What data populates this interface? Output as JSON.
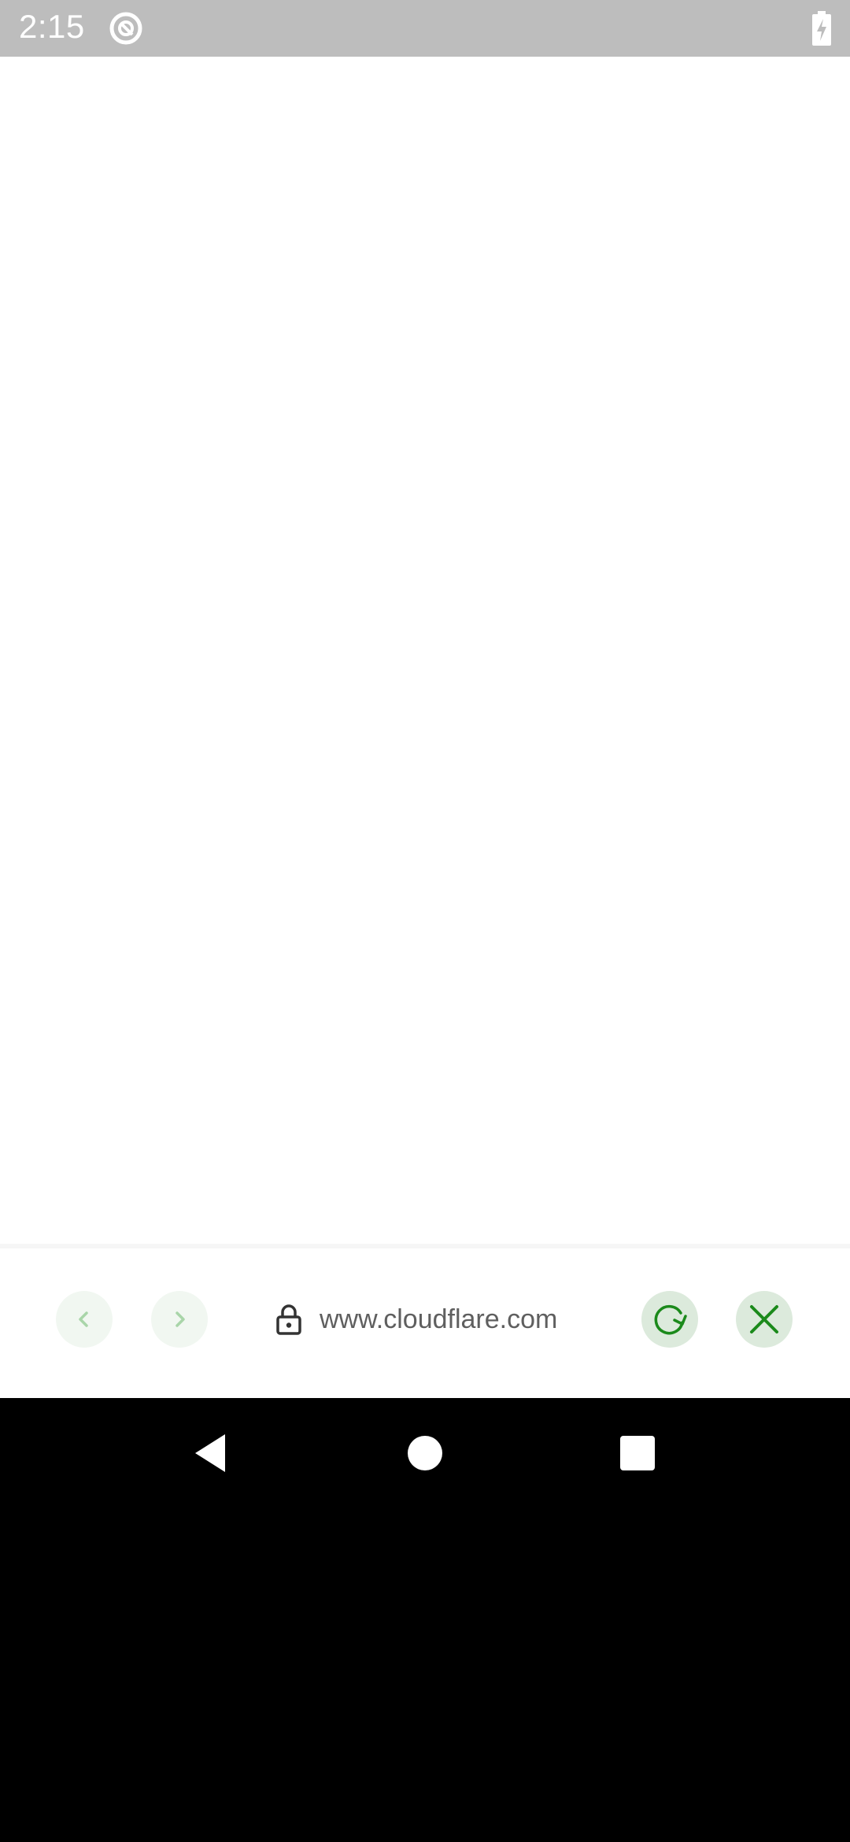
{
  "status_bar": {
    "time": "2:15",
    "app_icon": "at-sign-circle-icon",
    "battery_icon": "battery-charging-icon"
  },
  "webview": {
    "content": ""
  },
  "toolbar": {
    "back_icon": "chevron-left-icon",
    "forward_icon": "chevron-right-icon",
    "lock_icon": "lock-icon",
    "url": "www.cloudflare.com",
    "reload_icon": "reload-icon",
    "close_icon": "close-icon",
    "accent_color": "#1b8a1b"
  },
  "nav_bar": {
    "back_icon": "triangle-back-icon",
    "home_icon": "circle-home-icon",
    "recents_icon": "square-recents-icon"
  }
}
